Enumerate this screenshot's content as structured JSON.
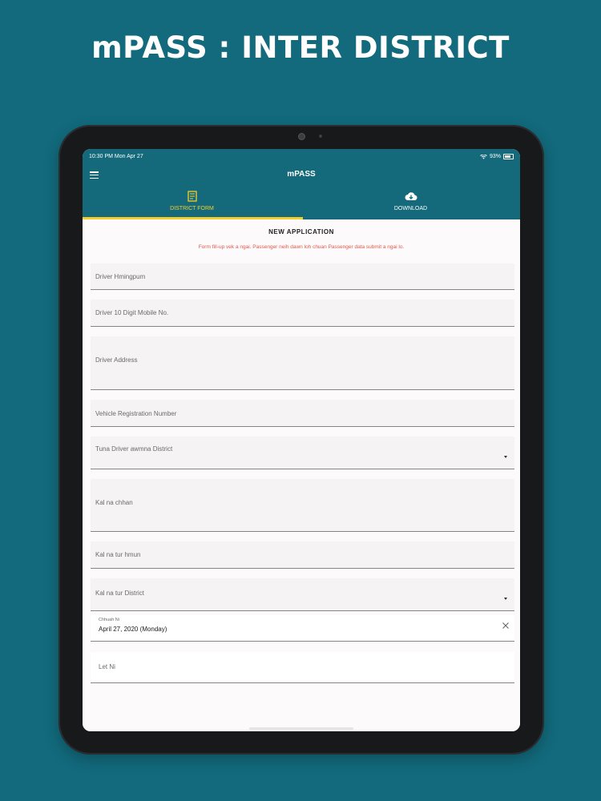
{
  "headline": "mPASS : INTER DISTRICT",
  "status_bar": {
    "time": "10:30 PM   Mon Apr 27",
    "battery": "93%"
  },
  "app_bar": {
    "title": "mPASS"
  },
  "tabs": [
    {
      "label": "DISTRICT FORM",
      "icon": "form-icon",
      "active": true
    },
    {
      "label": "DOWNLOAD",
      "icon": "cloud-download-icon",
      "active": false
    }
  ],
  "form": {
    "title": "NEW APPLICATION",
    "note": "Form fill-up vek a ngai. Passenger neih dawn loh chuan Passenger data submit a ngai lo.",
    "fields": {
      "driver_name": "Driver Hmingpum",
      "driver_mobile": "Driver 10 Digit Mobile No.",
      "driver_address": "Driver Address",
      "vehicle_reg": "Vehicle Registration Number",
      "driver_district": "Tuna Driver awmna District",
      "from_place": "Kal na chhan",
      "to_place": "Kal na tur hmun",
      "to_district": "Kal na tur District",
      "departure_date_label": "Chhuah Ni",
      "departure_date_value": "April 27, 2020 (Monday)",
      "return_date": "Let Ni"
    }
  },
  "colors": {
    "teal": "#14697b",
    "accent": "#f4cf2c",
    "note_red": "#e05a4e"
  }
}
